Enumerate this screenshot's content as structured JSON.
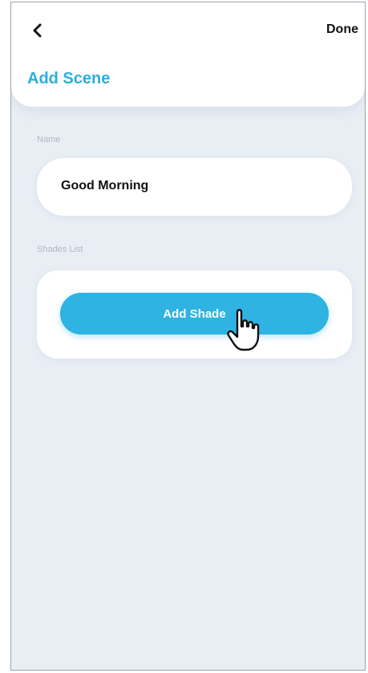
{
  "header": {
    "back_icon": "chevron-left-icon",
    "done_label": "Done",
    "title": "Add Scene"
  },
  "name_section": {
    "label": "Name",
    "value": "Good Morning"
  },
  "shades_section": {
    "label": "Shades List",
    "add_button_label": "Add Shade"
  },
  "cursor": {
    "icon": "pointer-hand-icon"
  },
  "colors": {
    "accent": "#2eb3e2",
    "title": "#2aaede",
    "background": "#e9eef5",
    "card": "#ffffff"
  }
}
